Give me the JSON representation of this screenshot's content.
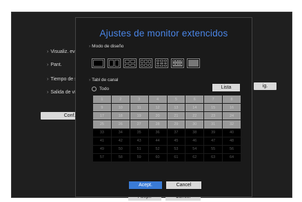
{
  "background": {
    "title": "",
    "rows": [
      {
        "label": "Visualiz. evento"
      },
      {
        "label": "Pant."
      },
      {
        "label": "Tiempo de secu"
      },
      {
        "label": "Salida de vídeo"
      }
    ],
    "conf_button": "Conf. p",
    "config_button": "ig.",
    "accept_button": "Acept.",
    "cancel_button": "Cancel"
  },
  "modal": {
    "title": "Ajustes de monitor extencidos",
    "layout_mode_label": "Modo de diseño",
    "layouts": [
      "1x1",
      "2x1",
      "2x2",
      "3x2",
      "3x3",
      "4x4",
      "5x5"
    ],
    "channel_table_label": "Tabl de canal",
    "all_option": "Todo",
    "list_button": "Lista",
    "channels_enabled": 32,
    "channels": [
      "1",
      "2",
      "3",
      "4",
      "5",
      "6",
      "7",
      "8",
      "9",
      "10",
      "11",
      "12",
      "13",
      "14",
      "15",
      "16",
      "17",
      "18",
      "19",
      "20",
      "21",
      "22",
      "23",
      "24",
      "25",
      "26",
      "27",
      "28",
      "29",
      "30",
      "31",
      "32",
      "33",
      "34",
      "35",
      "36",
      "37",
      "38",
      "39",
      "40",
      "41",
      "42",
      "43",
      "44",
      "45",
      "46",
      "47",
      "48",
      "49",
      "50",
      "51",
      "52",
      "53",
      "54",
      "55",
      "56",
      "57",
      "58",
      "59",
      "60",
      "61",
      "62",
      "63",
      "64"
    ],
    "accept_button": "Acept.",
    "cancel_button": "Cancel"
  },
  "colors": {
    "accent": "#3a7bd5",
    "title": "#4a86e8",
    "panel": "#1a1a1a"
  }
}
